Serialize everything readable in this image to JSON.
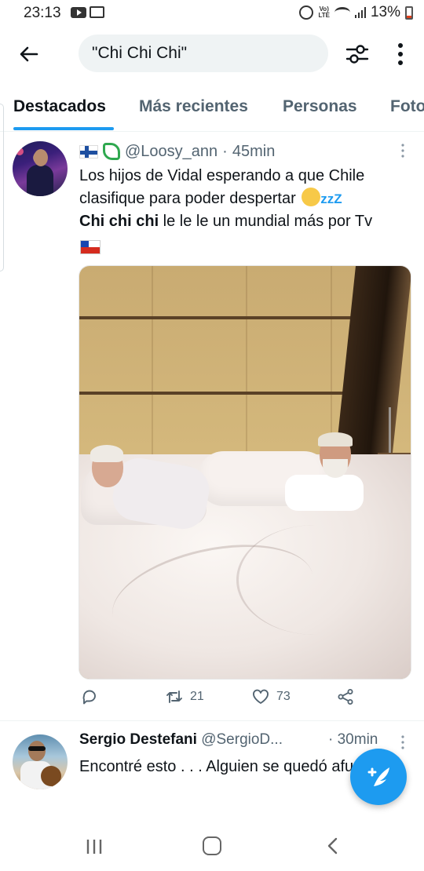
{
  "status_bar": {
    "time": "23:13",
    "volte": "VoLTE",
    "battery": "13%"
  },
  "search": {
    "query": "\"Chi Chi Chi\""
  },
  "tabs": [
    {
      "label": "Destacados",
      "active": true
    },
    {
      "label": "Más recientes",
      "active": false
    },
    {
      "label": "Personas",
      "active": false
    },
    {
      "label": "Fotos",
      "active": false
    }
  ],
  "tweet1": {
    "handle": "@Loosy_ann",
    "separator": "·",
    "time": "45min",
    "text_line1": "Los hijos de Vidal esperando a que Chile clasifique para poder despertar",
    "sleep_zz": "zzZ",
    "text_bold": "Chi chi chi",
    "text_rest": " le le le un mundial más por Tv",
    "retweets": "21",
    "likes": "73",
    "icons": [
      "finland-flag-emoji",
      "leaf-emoji",
      "sleeping-face-emoji",
      "chile-flag-emoji"
    ]
  },
  "tweet2": {
    "name": "Sergio Destefani",
    "handle": "@SergioD...",
    "separator": "·",
    "time": "30min",
    "text": "Encontré esto . . . Alguien se quedó afuera."
  },
  "colors": {
    "accent": "#1d9bf0",
    "text_primary": "#0f1419",
    "text_secondary": "#536471"
  }
}
